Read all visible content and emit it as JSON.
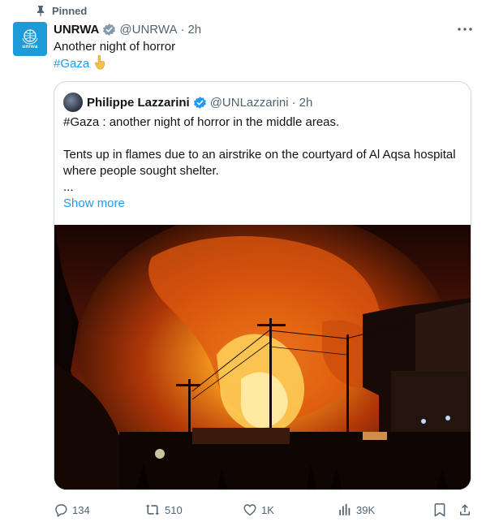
{
  "pinned": {
    "label": "Pinned",
    "icon": "pin-icon"
  },
  "tweet": {
    "name": "UNRWA",
    "handle": "@UNRWA",
    "separator": "·",
    "time": "2h",
    "text": "Another night of horror",
    "hashtag": "#Gaza",
    "emoji": "pointing-down-emoji"
  },
  "quote": {
    "name": "Philippe Lazzarini",
    "handle": "@UNLazzarini",
    "separator": "·",
    "time": "2h",
    "line1": "#Gaza : another night of horror in the middle areas.",
    "line2": "Tents up in flames due to an airstrike on the courtyard of Al Aqsa hospital where people sought shelter.",
    "line3": "...",
    "show_more": "Show more"
  },
  "actions": {
    "replies": "134",
    "reposts": "510",
    "likes": "1K",
    "views": "39K"
  },
  "colors": {
    "accent": "#1d9bf0",
    "muted": "#536471",
    "text": "#0f1419",
    "border": "#cfd9de"
  }
}
